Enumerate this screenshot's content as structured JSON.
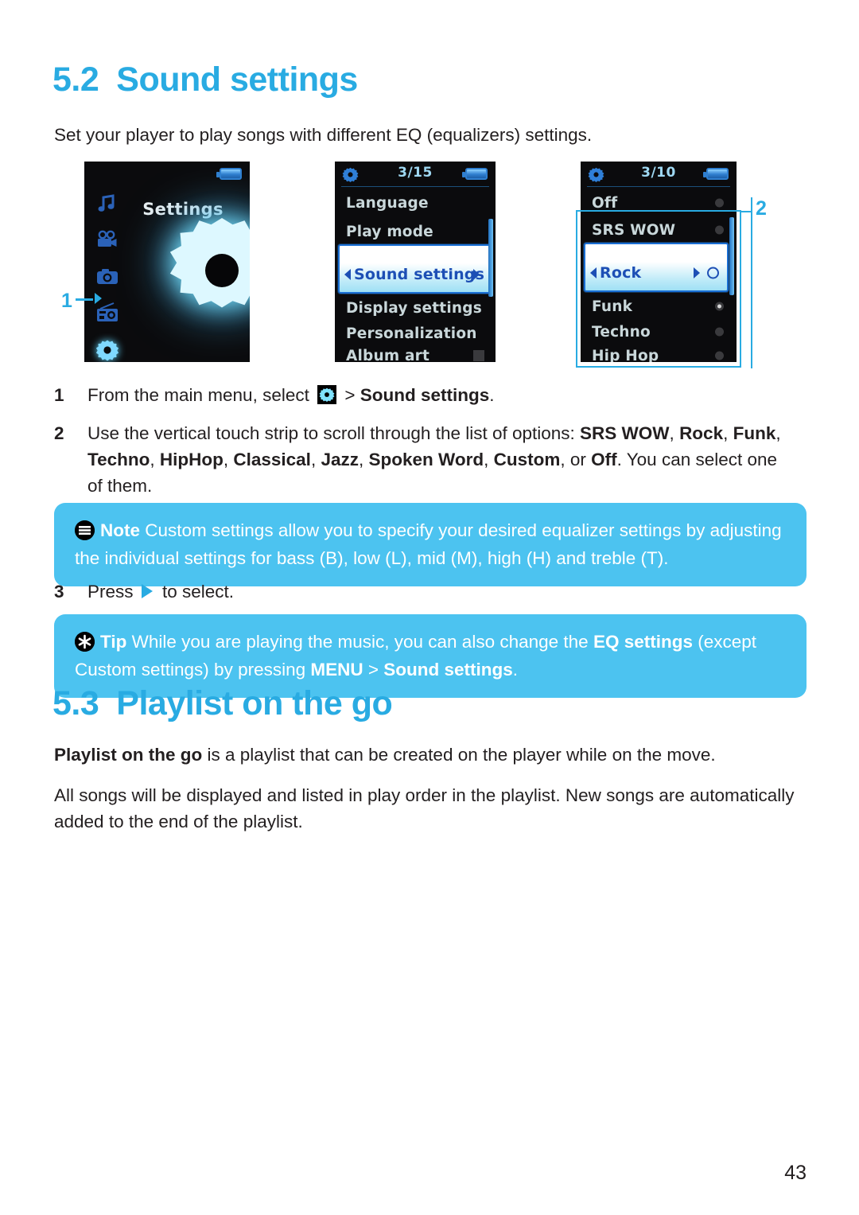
{
  "page": {
    "number": "43"
  },
  "sections": [
    {
      "id": "sound-settings",
      "number": "5.2",
      "title": "Sound settings",
      "intro": "Set your player to play songs with different EQ (equalizers) settings."
    },
    {
      "id": "playlist-on-the-go",
      "number": "5.3",
      "title": "Playlist on the go",
      "para1_bold": "Playlist on the go",
      "para1_rest": " is a playlist that can be created on the player while on the move.",
      "para2": "All songs will be displayed and listed in play order in the playlist. New songs are automatically added to the end of the playlist."
    }
  ],
  "steps": [
    {
      "number": "1",
      "text_before": "From the main menu, select ",
      "icon": "gear-icon",
      "text_mid": " > ",
      "text_bold": "Sound settings",
      "text_after": "."
    },
    {
      "number": "2",
      "text": "Use the vertical touch strip to scroll through the list of options: SRS WOW, Rock, Funk, Techno, HipHop, Classical, Jazz, Spoken Word, Custom, or Off. You can select one of them.",
      "options": [
        "SRS WOW",
        "Rock",
        "Funk",
        "Techno",
        "HipHop",
        "Classical",
        "Jazz",
        "Spoken Word",
        "Custom",
        "Off"
      ]
    },
    {
      "number": "3",
      "text_before": "Press ",
      "icon": "play-triangle-icon",
      "text_after": " to select."
    }
  ],
  "callouts": [
    {
      "type": "note",
      "icon": "note-icon",
      "lead": "Note",
      "text": " Custom settings allow you to specify your desired equalizer settings by adjusting the individual settings for bass (B), low (L), mid (M), high (H) and treble (T).",
      "color": "#4cc3f0"
    },
    {
      "type": "tip",
      "icon": "tip-star-icon",
      "lead": "Tip",
      "text_1": " While you are playing the music, you can also change the ",
      "bold_1": "EQ settings",
      "text_2": " (except Custom settings) by pressing ",
      "bold_2": "MENU",
      "text_3": " > ",
      "bold_3": "Sound settings",
      "text_4": ".",
      "color": "#4cc3f0"
    }
  ],
  "devices": [
    {
      "id": "main-menu",
      "title": "Settings",
      "battery": "battery-icon",
      "icon_list": [
        "music-note-icon",
        "video-camera-icon",
        "camera-icon",
        "radio-icon",
        "gear-icon"
      ],
      "selected_icon_index": 4,
      "big_icon": "gear-icon"
    },
    {
      "id": "settings-menu",
      "counter": "3/15",
      "battery": "battery-icon",
      "items": [
        {
          "label": "Language",
          "selected": false
        },
        {
          "label": "Play mode",
          "selected": false
        },
        {
          "label": "Sound settings",
          "selected": true
        },
        {
          "label": "Display settings",
          "selected": false
        },
        {
          "label": "Personalization",
          "selected": false
        },
        {
          "label": "Album art",
          "selected": false
        }
      ]
    },
    {
      "id": "eq-menu",
      "counter": "3/10",
      "battery": "battery-icon",
      "items": [
        {
          "label": "Off",
          "selected": false,
          "radio": "empty"
        },
        {
          "label": "SRS WOW",
          "selected": false,
          "radio": "empty"
        },
        {
          "label": "Rock",
          "selected": true,
          "radio": "empty"
        },
        {
          "label": "Funk",
          "selected": false,
          "radio": "filled"
        },
        {
          "label": "Techno",
          "selected": false,
          "radio": "empty"
        },
        {
          "label": "Hip Hop",
          "selected": false,
          "radio": "empty"
        }
      ]
    }
  ],
  "annotations": [
    {
      "label": "1",
      "target": "main-menu-settings-icon"
    },
    {
      "label": "2",
      "target": "eq-option-list"
    }
  ],
  "colors": {
    "accent": "#29abe2",
    "callout_bg": "#4cc3f0",
    "body_text": "#231f20",
    "screen_bg": "#0b0b0d",
    "screen_text": "#c9d7da",
    "selected_text": "#1d4fb5"
  }
}
